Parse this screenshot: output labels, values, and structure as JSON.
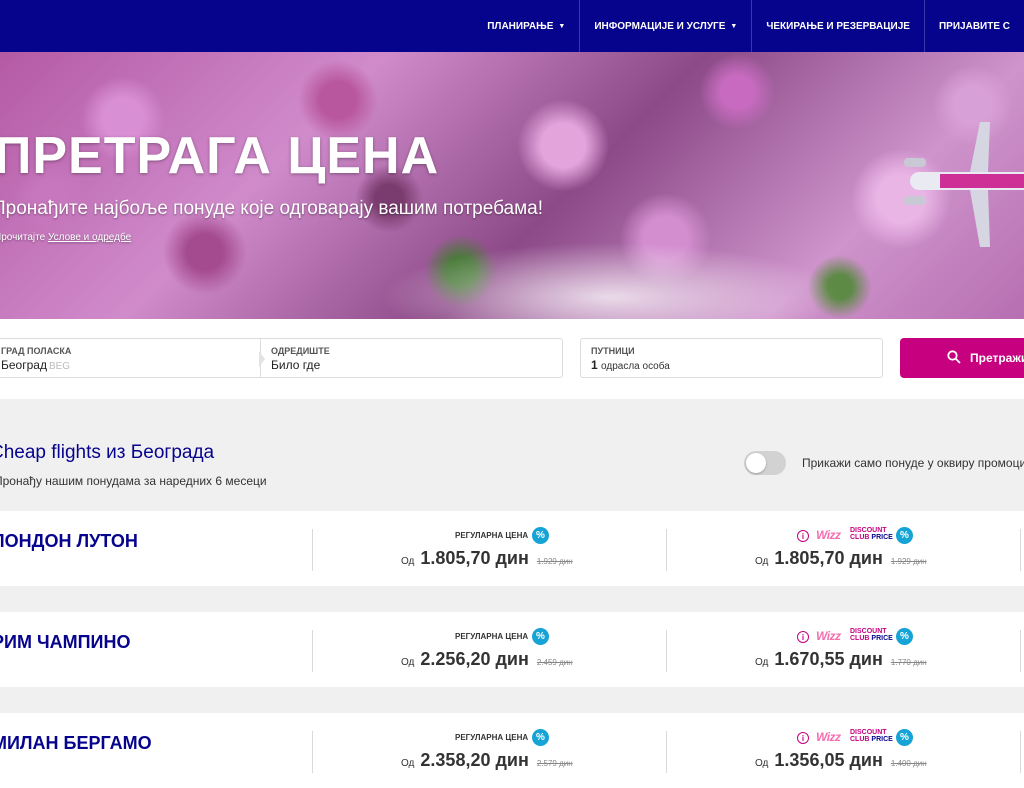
{
  "nav": {
    "items": [
      {
        "label": "ПЛАНИРАЊЕ",
        "dropdown": true
      },
      {
        "label": "ИНФОРМАЦИЈЕ И УСЛУГЕ",
        "dropdown": true
      },
      {
        "label": "ЧЕКИРАЊЕ И РЕЗЕРВАЦИЈЕ",
        "dropdown": false
      },
      {
        "label": "ПРИЈАВИТЕ С",
        "dropdown": false
      }
    ]
  },
  "hero": {
    "title": "ПРЕТРАГА ЦЕНА",
    "subtitle": "Пронађите најбоље понуде које одговарају вашим потребама!",
    "terms_prefix": "Прочитајте",
    "terms_link": "Услове и одредбе"
  },
  "search": {
    "origin_label": "ГРАД ПОЛАСКА",
    "origin_value": "Београд",
    "origin_code": "BEG",
    "dest_label": "ОДРЕДИШТЕ",
    "dest_value": "Било где",
    "pax_label": "ПУТНИЦИ",
    "pax_count": "1",
    "pax_type": "одрасла особа",
    "button_label": "Претражи"
  },
  "results": {
    "title": "Cheap flights из Београда",
    "subtitle": "Пронађу нашим понудама за наредних 6 месеци",
    "toggle_label": "Прикажи само понуде у оквиру промоције",
    "toggle_on": false,
    "regular_label": "РЕГУЛАРНА ЦЕНА",
    "from_label": "Од",
    "wdc_logo": "Wizz",
    "wdc_line1": "DISCOUNT",
    "wdc_line2_a": "CLUB",
    "wdc_line2_b": "PRICE",
    "cards": [
      {
        "destination": "ЛОНДОН ЛУТОН",
        "regular_price": "1.805,70 дин",
        "regular_old": "1.929 дин",
        "wdc_price": "1.805,70 дин",
        "wdc_old": "1.929 дин"
      },
      {
        "destination": "РИМ ЧАМПИНО",
        "regular_price": "2.256,20 дин",
        "regular_old": "2.459 дин",
        "wdc_price": "1.670,55 дин",
        "wdc_old": "1.770 дин"
      },
      {
        "destination": "МИЛАН БЕРГАМО",
        "regular_price": "2.358,20 дин",
        "regular_old": "2.579 дин",
        "wdc_price": "1.356,05 дин",
        "wdc_old": "1.400 дин"
      }
    ]
  },
  "colors": {
    "nav_bg": "#06038d",
    "accent": "#c6007e",
    "discount_badge": "#16a3d5",
    "results_bg": "#f0f0f0"
  }
}
